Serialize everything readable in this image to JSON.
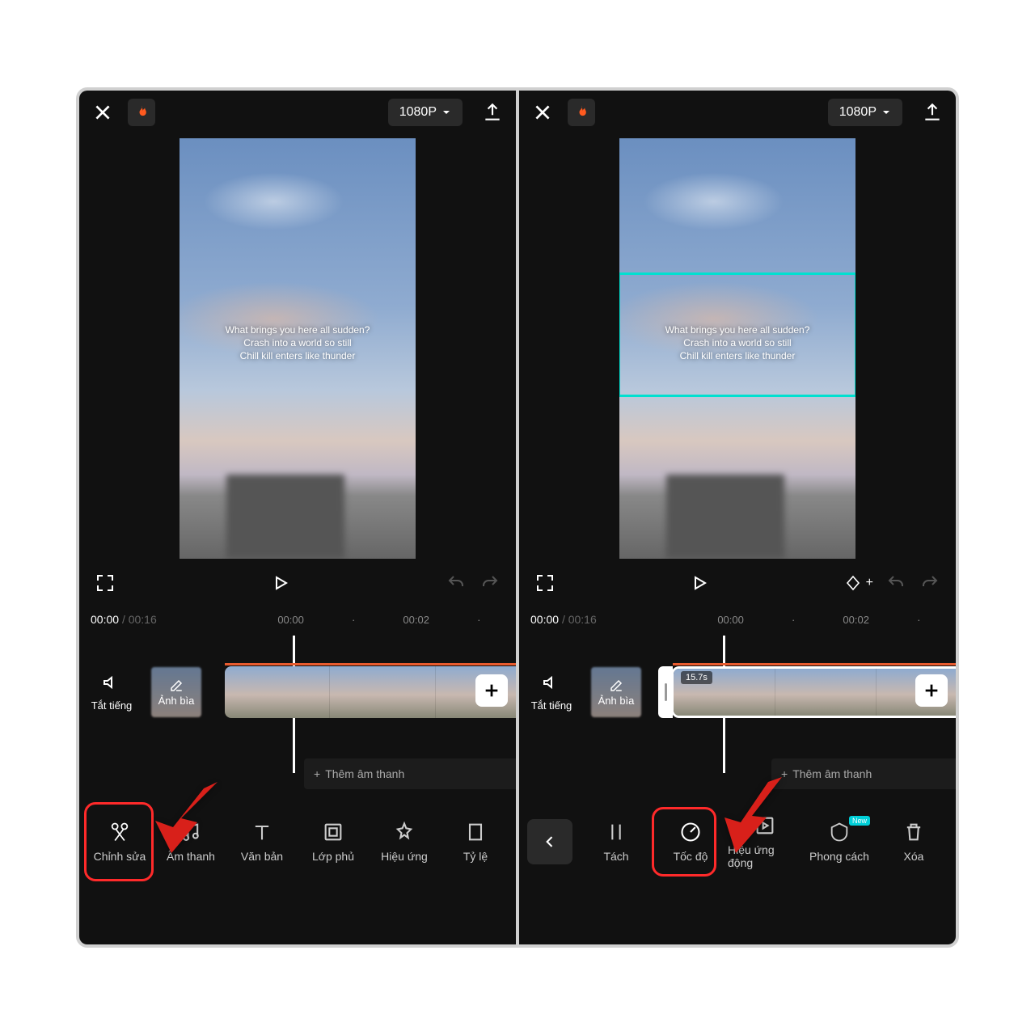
{
  "topbar": {
    "resolution": "1080P"
  },
  "overlay": {
    "line1": "What brings you here all sudden?",
    "line2": "Crash into a world so still",
    "line3": "Chill kill enters like thunder"
  },
  "time": {
    "current": "00:00",
    "sep": "/",
    "total": "00:16",
    "ticks_left": [
      "00:00",
      "00:02"
    ],
    "ticks_right": [
      "00:00",
      "00:02"
    ]
  },
  "timeline": {
    "mute": "Tắt tiếng",
    "cover": "Ảnh bìa",
    "add_audio": "Thêm âm thanh",
    "clip_duration": "15.7s"
  },
  "toolbar_left": [
    {
      "label": "Chỉnh sửa"
    },
    {
      "label": "Âm thanh"
    },
    {
      "label": "Văn bản"
    },
    {
      "label": "Lớp phủ"
    },
    {
      "label": "Hiệu ứng"
    },
    {
      "label": "Tỷ lệ"
    }
  ],
  "toolbar_right": [
    {
      "label": "Tách"
    },
    {
      "label": "Tốc độ"
    },
    {
      "label": "Hiệu ứng động"
    },
    {
      "label": "Phong cách",
      "badge": "New"
    },
    {
      "label": "Xóa"
    }
  ]
}
